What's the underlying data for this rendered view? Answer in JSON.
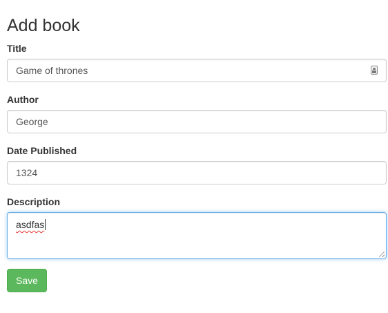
{
  "page": {
    "heading": "Add book"
  },
  "form": {
    "title": {
      "label": "Title",
      "value": "Game of thrones",
      "icon": "autofill-contact-icon"
    },
    "author": {
      "label": "Author",
      "value": "George"
    },
    "date_published": {
      "label": "Date Published",
      "value": "1324"
    },
    "description": {
      "label": "Description",
      "value": "asdfas",
      "focused": true,
      "spellcheck_error": true
    },
    "save_label": "Save"
  },
  "colors": {
    "primary_success": "#5cb85c",
    "focus_border": "#66afe9",
    "text": "#333333",
    "input_border": "#cccccc"
  }
}
